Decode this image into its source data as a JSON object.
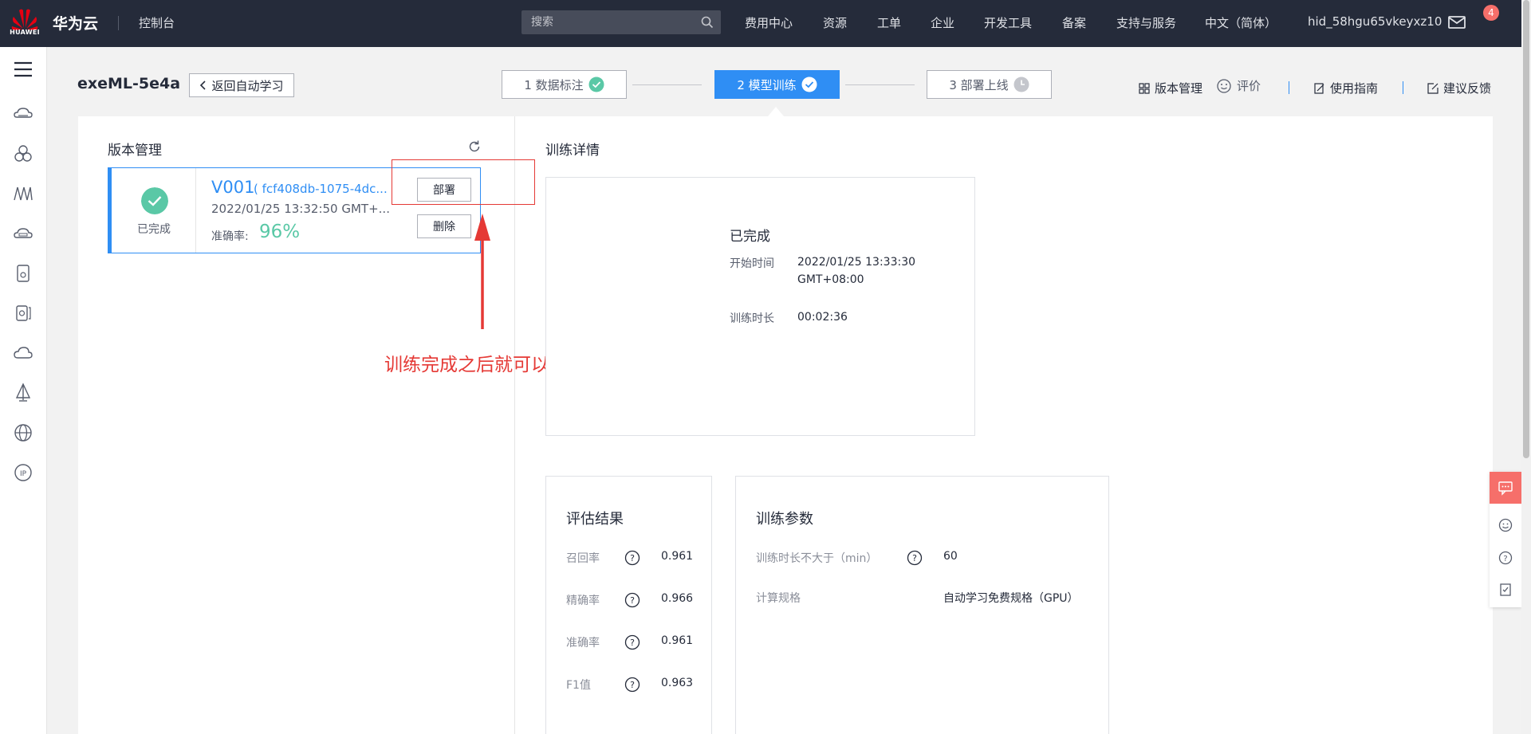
{
  "topbar": {
    "logo_text": "HUAWEI",
    "brand": "华为云",
    "console": "控制台",
    "search_placeholder": "搜索",
    "nav": [
      "费用中心",
      "资源",
      "工单",
      "企业",
      "开发工具",
      "备案",
      "支持与服务",
      "中文（简体）",
      "hid_58hgu65vkeyxz10"
    ],
    "mail_badge": "4"
  },
  "rail": {
    "icons": [
      "menu-icon",
      "cloud-service-icon",
      "network-icon",
      "data-analytics-icon",
      "storage-icon",
      "document-icon",
      "database-icon",
      "cloud-icon",
      "modelarts-icon",
      "web-icon",
      "ip-icon"
    ]
  },
  "header": {
    "project_title": "exeML-5e4a",
    "back_label": "返回自动学习",
    "steps": [
      {
        "label": "1 数据标注",
        "state": "done"
      },
      {
        "label": "2 模型训练",
        "state": "active"
      },
      {
        "label": "3 部署上线",
        "state": "pending"
      }
    ],
    "links": {
      "version_mgmt": "版本管理",
      "rate": "评价",
      "guide": "使用指南",
      "feedback": "建议反馈"
    }
  },
  "version_panel": {
    "title": "版本管理",
    "card": {
      "status": "已完成",
      "name": "V001",
      "id": "( fcf408db-1075-4dc...",
      "time": "2022/01/25 13:32:50 GMT+...",
      "accuracy_label": "准确率:",
      "accuracy_value": "96%",
      "deploy_label": "部署",
      "delete_label": "删除"
    }
  },
  "annotation": "训练完成之后就可以部署了",
  "training_detail": {
    "title": "训练详情",
    "status": "已完成",
    "start_label": "开始时间",
    "start_value_line1": "2022/01/25 13:33:30",
    "start_value_line2": "GMT+08:00",
    "duration_label": "训练时长",
    "duration_value": "00:02:36"
  },
  "evaluation": {
    "title": "评估结果",
    "rows": [
      {
        "label": "召回率",
        "value": "0.961"
      },
      {
        "label": "精确率",
        "value": "0.966"
      },
      {
        "label": "准确率",
        "value": "0.961"
      },
      {
        "label": "F1值",
        "value": "0.963"
      }
    ]
  },
  "train_params": {
    "title": "训练参数",
    "max_time_label": "训练时长不大于（min）",
    "max_time_value": "60",
    "spec_label": "计算规格",
    "spec_value": "自动学习免费规格（GPU）"
  },
  "colors": {
    "accent": "#2f8ef4",
    "success": "#5ac8a6",
    "annotation": "#e53935",
    "topbar": "#252b3a"
  }
}
